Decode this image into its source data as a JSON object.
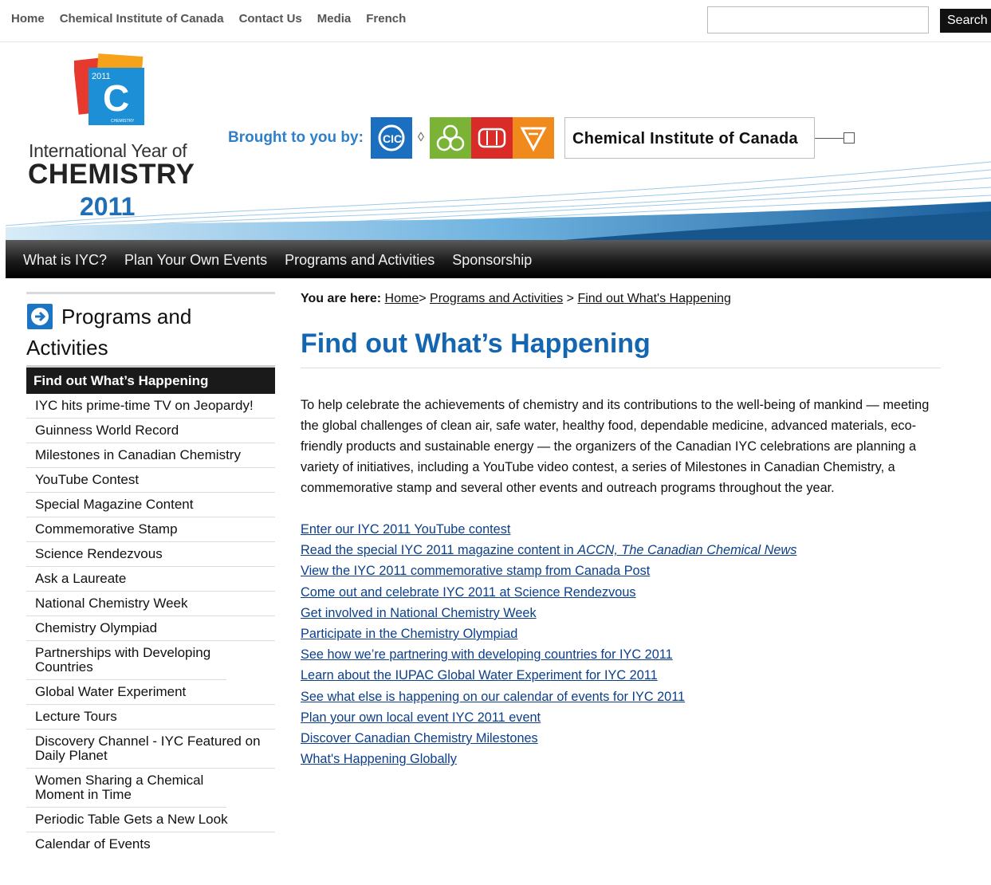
{
  "top_nav": {
    "items": [
      "Home",
      "Chemical Institute of Canada",
      "Contact Us",
      "Media",
      "French"
    ],
    "search_placeholder": "",
    "search_button": "Search"
  },
  "header": {
    "logo": {
      "year_tag": "2011",
      "letter": "C",
      "ribbon": "CHEMISTRY",
      "line1": "International Year of",
      "line2": "CHEMISTRY",
      "line3": "2011"
    },
    "brought_by": "Brought to you by:",
    "org_logos": [
      {
        "abbr": "CIC",
        "color": "#1b6fc0"
      },
      {
        "abbr": "SCC",
        "color": "#7ab335"
      },
      {
        "abbr": "CSChE",
        "color": "#d92b27"
      },
      {
        "abbr": "CSC",
        "color": "#f08a1c"
      }
    ],
    "diamond": "◊",
    "org_name": "Chemical Institute of Canada"
  },
  "main_nav": {
    "items": [
      "What is IYC?",
      "Plan Your Own Events",
      "Programs and Activities",
      "Sponsorship"
    ]
  },
  "sidebar": {
    "title_line1": "Programs and",
    "title_line2": "Activities",
    "active": "Find out What’s Happening",
    "items": [
      "IYC hits prime-time TV on Jeopardy!",
      "Guinness World Record",
      "Milestones in Canadian Chemistry",
      "YouTube Contest",
      "Special Magazine Content",
      "Commemorative Stamp",
      "Science Rendezvous",
      "Ask a Laureate",
      "National Chemistry Week",
      "Chemistry Olympiad",
      "Partnerships with Developing Countries",
      "Global Water Experiment",
      "Lecture Tours",
      "Discovery Channel - IYC Featured on Daily Planet",
      "Women Sharing a Chemical Moment in Time",
      "Periodic Table Gets a New Look",
      "Calendar of Events"
    ]
  },
  "breadcrumb": {
    "label": "You are here:",
    "home": "Home",
    "sep1": "> ",
    "section": "Programs and Activities",
    "sep2": " > ",
    "current": "Find out What's Happening"
  },
  "content": {
    "title": "Find out What’s Happening",
    "intro": "To help celebrate the achievements of chemistry and its contributions to the well-being of mankind — meeting the global challenges of clean air, safe water, healthy food, dependable medicine, advanced materials, eco-friendly products and sustainable energy — the organizers of the Canadian IYC celebrations are planning a variety of initiatives, including a YouTube video contest, a series of Milestones in Canadian Chemistry, a commemorative stamp and several other events and outreach programs throughout the year.",
    "links": [
      "Enter our IYC 2011 YouTube contest",
      "Read the special IYC 2011 magazine content in ",
      "View the IYC 2011 commemorative stamp from Canada Post",
      "Come out and celebrate IYC 2011 at Science Rendezvous",
      "Get involved in National Chemistry Week",
      "Participate in the Chemistry Olympiad",
      "See how we’re partnering with developing countries for IYC 2011",
      "Learn about the IUPAC Global Water Experiment for IYC 2011",
      "See what else is happening on our calendar of events for IYC 2011",
      "Plan your own local event IYC 2011 event",
      "Discover Canadian Chemistry Milestones",
      "What's Happening Globally"
    ],
    "magazine_italic": "ACCN, The Canadian Chemical News"
  },
  "colors": {
    "accent_blue": "#1566b0",
    "nav_dark": "#1b1b1b",
    "link": "#0b3f8a"
  }
}
